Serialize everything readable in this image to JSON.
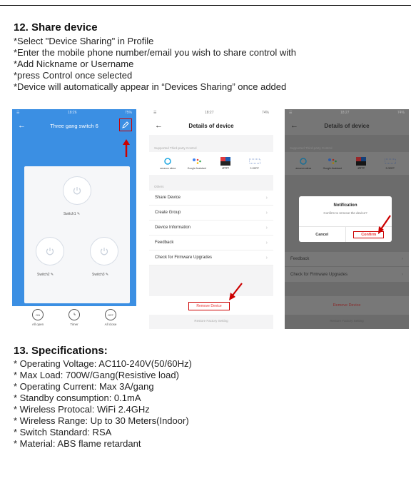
{
  "section12": {
    "title": "12. Share device",
    "lines": [
      "*Select \"Device Sharing\" in Profile",
      "*Enter the mobile phone number/email you wish to share control with",
      "*Add Nickname or Username",
      "*press Control once selected",
      "*Device will automatically appear in “Devices Sharing” once added"
    ]
  },
  "phone1": {
    "status_time": "18:26",
    "status_battery": "75%",
    "title": "Three gang switch 6",
    "switches": [
      "Switch1",
      "Switch2",
      "Switch3"
    ],
    "bottom": [
      {
        "icon": "ON",
        "label": "All open"
      },
      {
        "icon": "",
        "label": "Timer"
      },
      {
        "icon": "OFF",
        "label": "All close"
      }
    ]
  },
  "phone2": {
    "status_time": "18:27",
    "status_battery": "74%",
    "title": "Details of device",
    "third_party_header": "Supported Third-party Control",
    "third_party": [
      "amazon alexa",
      "Google Assistant",
      "IFTTT",
      "3 GERT"
    ],
    "others_header": "Others",
    "menu": [
      "Share Device",
      "Create Group",
      "Device Information",
      "Feedback",
      "Check for Firmware Upgrades"
    ],
    "remove": "Remove Device",
    "restore": "Restore Factory Setting"
  },
  "phone3": {
    "status_time": "18:27",
    "status_battery": "74%",
    "title": "Details of device",
    "third_party_header": "Supported Third-party Control",
    "third_party": [
      "amazon alexa",
      "Google Assistant",
      "IFTTT",
      "3 GERT"
    ],
    "menu_visible": [
      "Feedback",
      "Check for Firmware Upgrades"
    ],
    "dialog_title": "Notification",
    "dialog_message": "Confirm to remove the device?",
    "cancel": "Cancel",
    "confirm": "Confirm",
    "remove": "Remove Device",
    "restore": "Restore Factory Setting"
  },
  "section13": {
    "title": "13. Specifications:",
    "lines": [
      "* Operating Voltage: AC110-240V(50/60Hz)",
      "* Max Load: 700W/Gang(Resistive load)",
      "* Operating Current: Max 3A/gang",
      "* Standby consumption: 0.1mA",
      "* Wireless Protocal: WiFi 2.4GHz",
      "* Wireless Range: Up to 30 Meters(Indoor)",
      "* Switch Standard: RSA",
      "* Material: ABS flame retardant"
    ]
  },
  "colors": {
    "app_blue": "#3b8fe3",
    "highlight_red": "#cc0000"
  }
}
